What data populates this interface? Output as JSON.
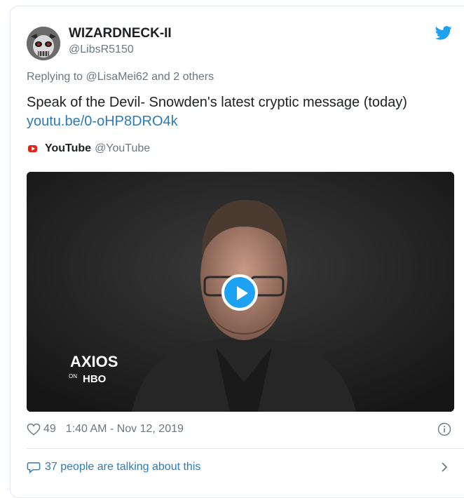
{
  "author": {
    "name": "WIZARDNECK-II",
    "handle": "@LibsR5150"
  },
  "reply": {
    "prefix": "Replying to ",
    "target": "@LisaMei62",
    "suffix": " and 2 others"
  },
  "tweet": {
    "text": "Speak of the Devil- Snowden's latest cryptic message (today)",
    "url": "youtu.be/0-oHP8DRO4k"
  },
  "source": {
    "name": "YouTube",
    "handle": "@YouTube"
  },
  "video": {
    "overlay_top": "AXIOS",
    "overlay_on": "ON",
    "overlay_bottom": "HBO"
  },
  "meta": {
    "likes": "49",
    "timestamp": "1:40 AM - Nov 12, 2019"
  },
  "conversation": {
    "label": "37 people are talking about this"
  },
  "colors": {
    "accent": "#1da1f2",
    "link": "#2b7bb9",
    "muted": "#697882",
    "youtube_red": "#e62117"
  }
}
